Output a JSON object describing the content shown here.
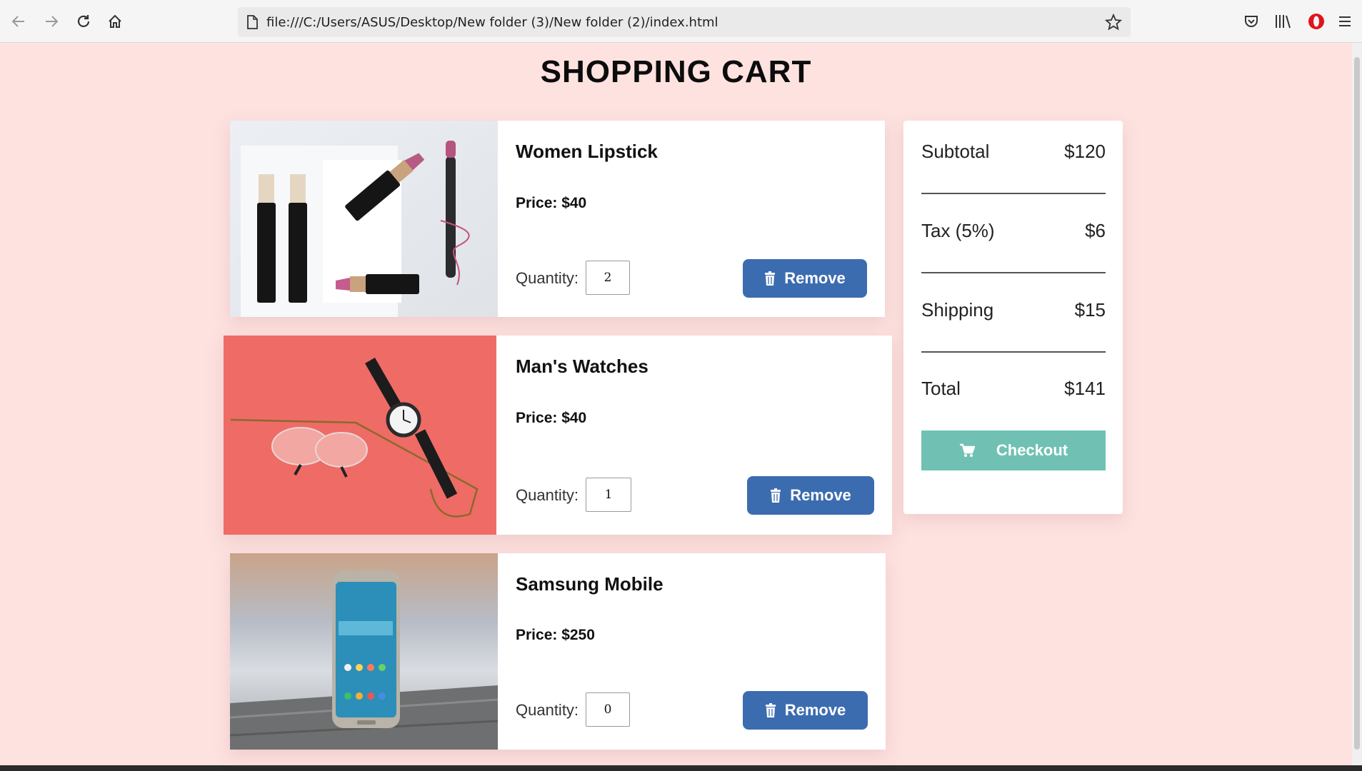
{
  "browser": {
    "url": "file:///C:/Users/ASUS/Desktop/New folder (3)/New folder (2)/index.html",
    "icons": [
      "back-icon",
      "forward-icon",
      "reload-icon",
      "home-icon",
      "page-icon",
      "bookmark-star-icon",
      "pocket-icon",
      "library-icon",
      "opera-icon",
      "menu-icon"
    ]
  },
  "page": {
    "title": "SHOPPING CART"
  },
  "cart": {
    "items": [
      {
        "name": "Women Lipstick",
        "price": "Price: $40",
        "quantity_label": "Quantity:",
        "quantity": "2",
        "remove_label": "Remove",
        "image": "lipstick-photo"
      },
      {
        "name": "Man's Watches",
        "price": "Price: $40",
        "quantity_label": "Quantity:",
        "quantity": "1",
        "remove_label": "Remove",
        "image": "watch-photo"
      },
      {
        "name": "Samsung Mobile",
        "price": "Price: $250",
        "quantity_label": "Quantity:",
        "quantity": "0",
        "remove_label": "Remove",
        "image": "phone-photo"
      }
    ]
  },
  "summary": {
    "subtotal_label": "Subtotal",
    "subtotal": "$120",
    "tax_label": "Tax (5%)",
    "tax": "$6",
    "shipping_label": "Shipping",
    "shipping": "$15",
    "total_label": "Total",
    "total": "$141",
    "checkout_label": "Checkout"
  },
  "colors": {
    "page_bg": "#fde2e0",
    "remove_button": "#3c6cb0",
    "checkout_button": "#70c1b3",
    "watch_photo_bg": "#ef6b66"
  }
}
